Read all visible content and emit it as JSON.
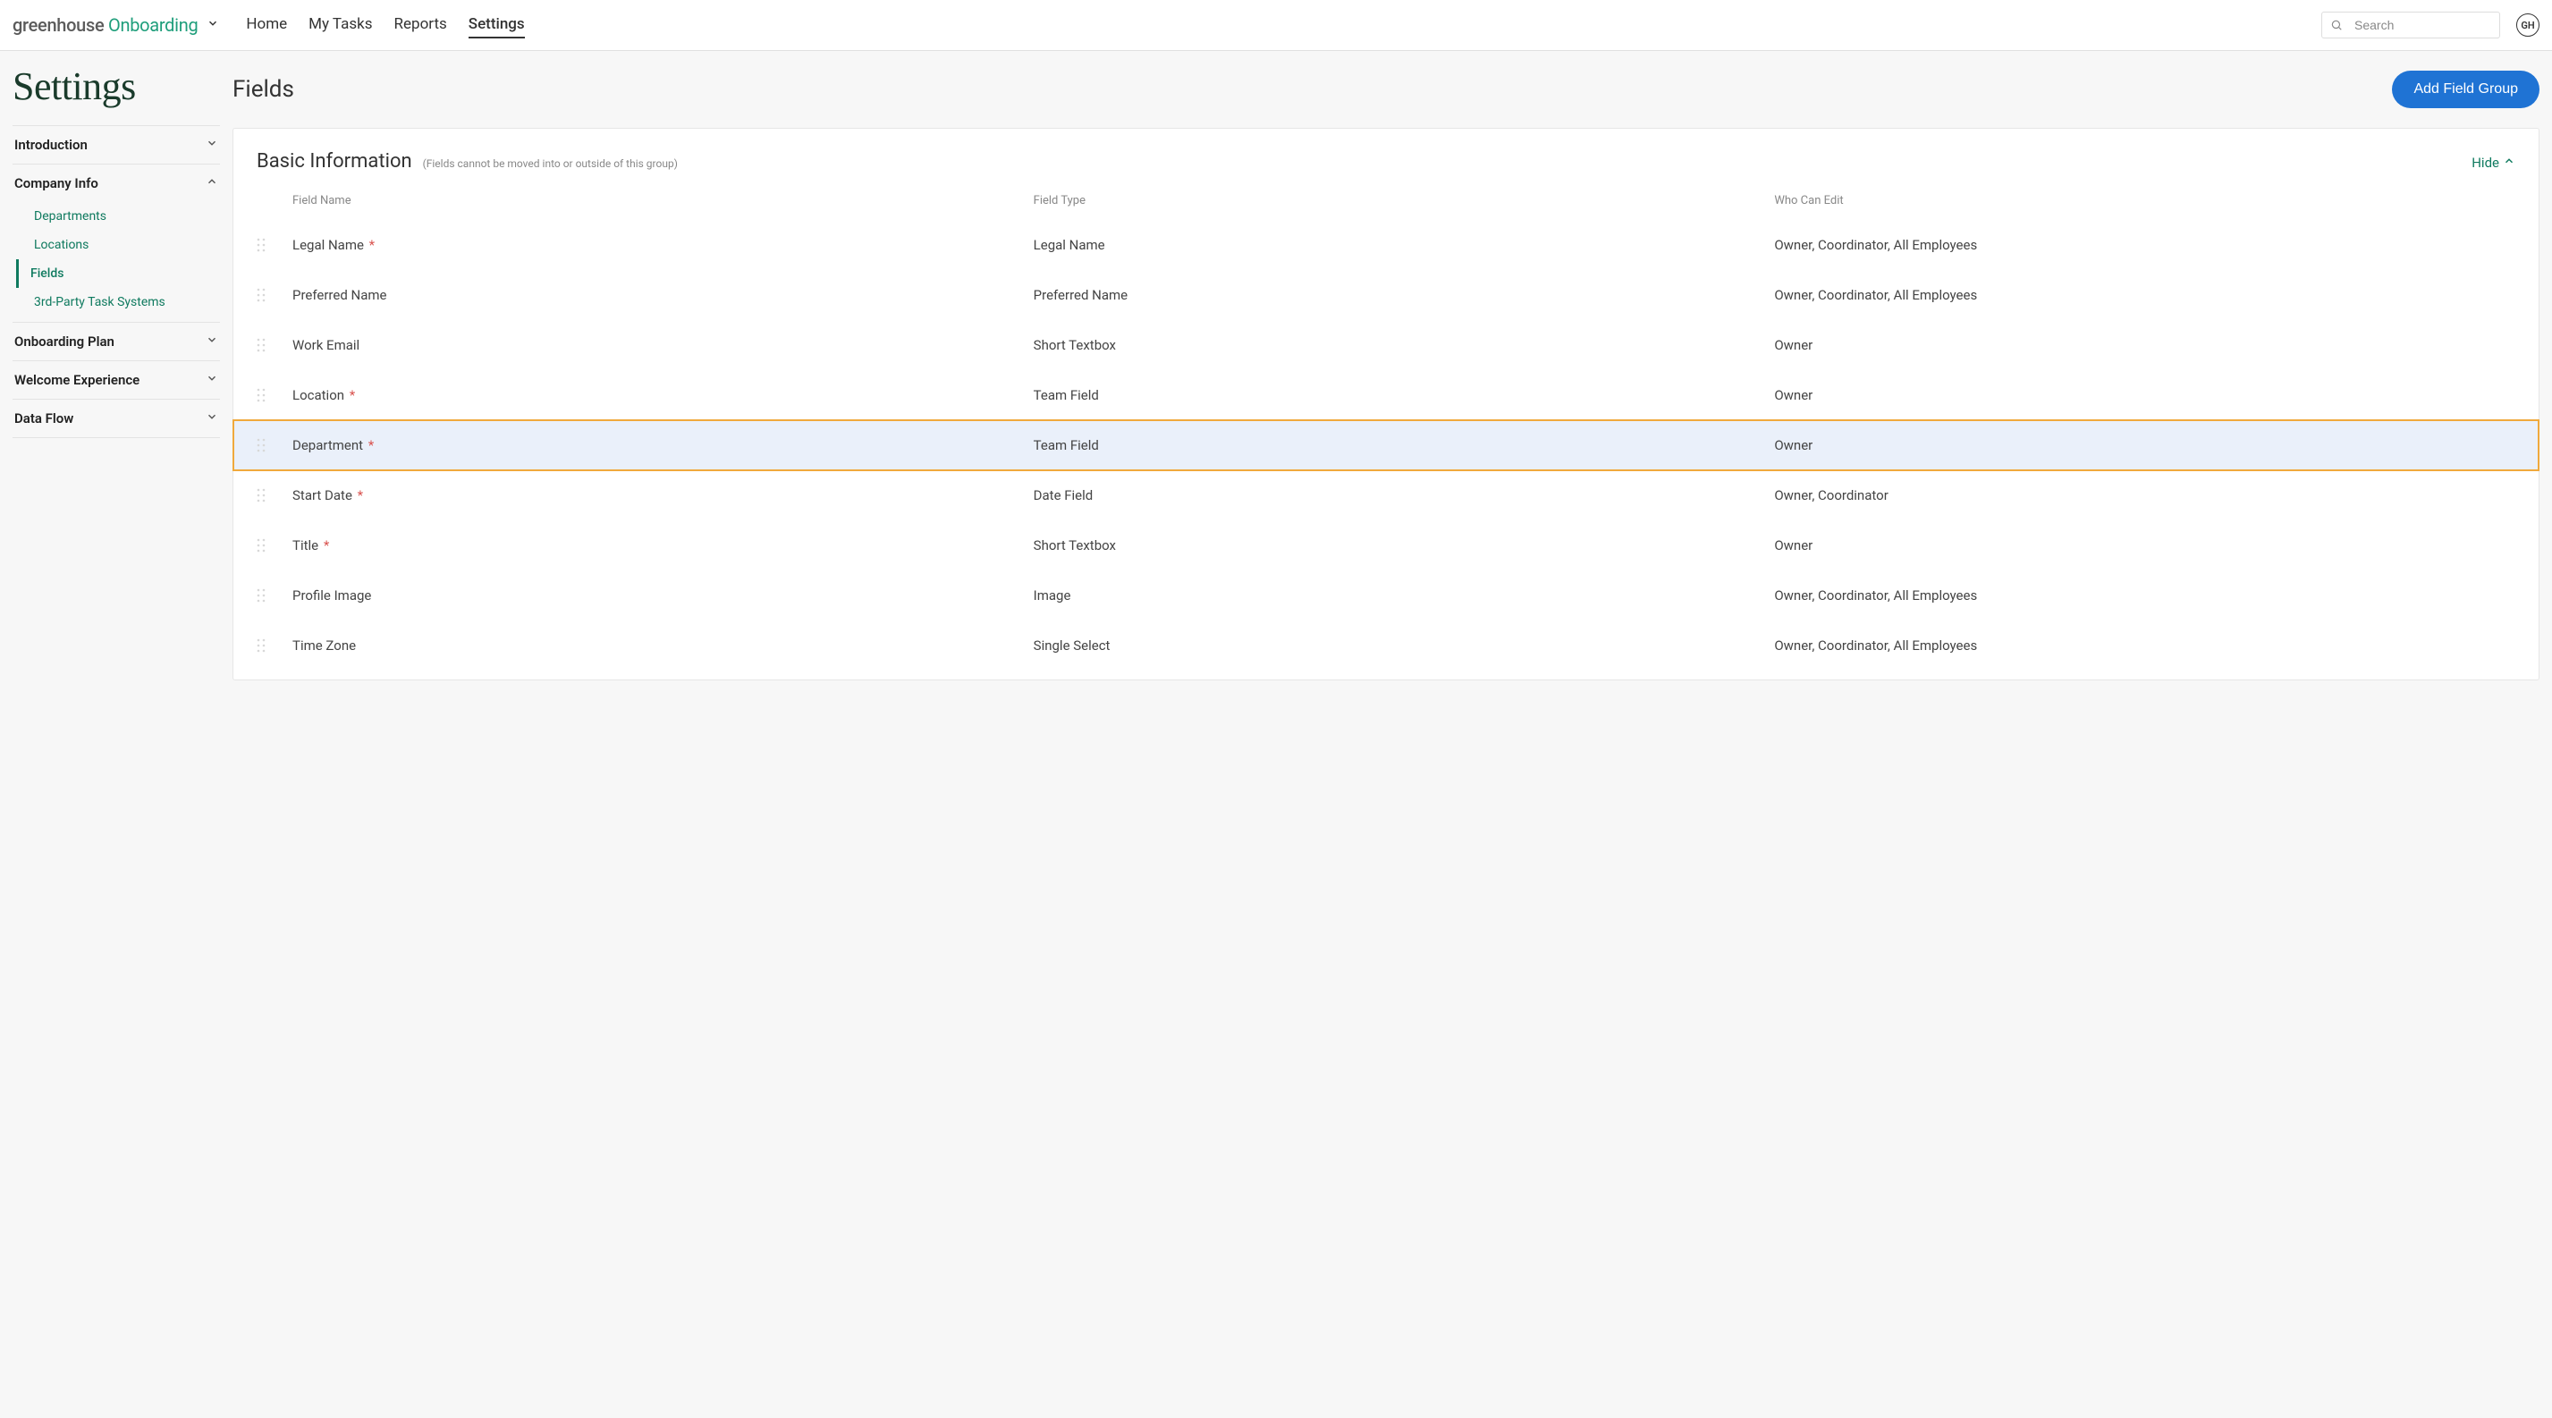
{
  "brand": {
    "greenhouse": "greenhouse",
    "onboarding": "Onboarding"
  },
  "nav": {
    "items": [
      {
        "label": "Home",
        "active": false
      },
      {
        "label": "My Tasks",
        "active": false
      },
      {
        "label": "Reports",
        "active": false
      },
      {
        "label": "Settings",
        "active": true
      }
    ]
  },
  "search": {
    "placeholder": "Search"
  },
  "avatar": {
    "initials": "GH"
  },
  "page": {
    "title": "Settings"
  },
  "sidebar": {
    "sections": [
      {
        "label": "Introduction",
        "expanded": false
      },
      {
        "label": "Company Info",
        "expanded": true,
        "items": [
          {
            "label": "Departments",
            "active": false
          },
          {
            "label": "Locations",
            "active": false
          },
          {
            "label": "Fields",
            "active": true
          },
          {
            "label": "3rd-Party Task Systems",
            "active": false
          }
        ]
      },
      {
        "label": "Onboarding Plan",
        "expanded": false
      },
      {
        "label": "Welcome Experience",
        "expanded": false
      },
      {
        "label": "Data Flow",
        "expanded": false
      }
    ]
  },
  "main": {
    "title": "Fields",
    "add_button": "Add Field Group"
  },
  "card": {
    "title": "Basic Information",
    "note": "(Fields cannot be moved into or outside of this group)",
    "hide_label": "Hide",
    "columns": {
      "name": "Field Name",
      "type": "Field Type",
      "who": "Who Can Edit"
    },
    "rows": [
      {
        "name": "Legal Name",
        "required": true,
        "type": "Legal Name",
        "who": "Owner, Coordinator, All Employees",
        "highlight": false
      },
      {
        "name": "Preferred Name",
        "required": false,
        "type": "Preferred Name",
        "who": "Owner, Coordinator, All Employees",
        "highlight": false
      },
      {
        "name": "Work Email",
        "required": false,
        "type": "Short Textbox",
        "who": "Owner",
        "highlight": false
      },
      {
        "name": "Location",
        "required": true,
        "type": "Team Field",
        "who": "Owner",
        "highlight": false
      },
      {
        "name": "Department",
        "required": true,
        "type": "Team Field",
        "who": "Owner",
        "highlight": true
      },
      {
        "name": "Start Date",
        "required": true,
        "type": "Date Field",
        "who": "Owner, Coordinator",
        "highlight": false
      },
      {
        "name": "Title",
        "required": true,
        "type": "Short Textbox",
        "who": "Owner",
        "highlight": false
      },
      {
        "name": "Profile Image",
        "required": false,
        "type": "Image",
        "who": "Owner, Coordinator, All Employees",
        "highlight": false
      },
      {
        "name": "Time Zone",
        "required": false,
        "type": "Single Select",
        "who": "Owner, Coordinator, All Employees",
        "highlight": false
      }
    ]
  }
}
